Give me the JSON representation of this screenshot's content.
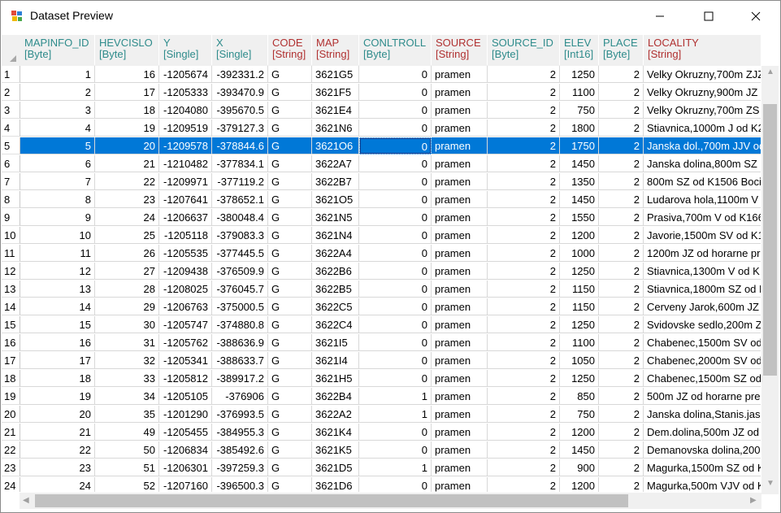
{
  "window": {
    "title": "Dataset Preview"
  },
  "columns": [
    {
      "name": "MAPINFO_ID",
      "type": "[Byte]",
      "color": "#2e8b8b"
    },
    {
      "name": "HEVCISLO",
      "type": "[Byte]",
      "color": "#2e8b8b"
    },
    {
      "name": "Y",
      "type": "[Single]",
      "color": "#2e8b8b"
    },
    {
      "name": "X",
      "type": "[Single]",
      "color": "#2e8b8b"
    },
    {
      "name": "CODE",
      "type": "[String]",
      "color": "#b03030"
    },
    {
      "name": "MAP",
      "type": "[String]",
      "color": "#b03030"
    },
    {
      "name": "CONLTROLL",
      "type": "[Byte]",
      "color": "#2e8b8b"
    },
    {
      "name": "SOURCE",
      "type": "[String]",
      "color": "#b03030"
    },
    {
      "name": "SOURCE_ID",
      "type": "[Byte]",
      "color": "#2e8b8b"
    },
    {
      "name": "ELEV",
      "type": "[Int16]",
      "color": "#2e8b8b"
    },
    {
      "name": "PLACE",
      "type": "[Byte]",
      "color": "#2e8b8b"
    },
    {
      "name": "LOCALITY",
      "type": "[String]",
      "color": "#b03030"
    }
  ],
  "selected_row": 5,
  "rows": [
    {
      "n": "1",
      "v": [
        "1",
        "16",
        "-1205674",
        "-392331.2",
        "G",
        "3621G5",
        "0",
        "pramen",
        "2",
        "1250",
        "2",
        "Velky Okruzny,700m ZJZ"
      ]
    },
    {
      "n": "2",
      "v": [
        "2",
        "17",
        "-1205333",
        "-393470.9",
        "G",
        "3621F5",
        "0",
        "pramen",
        "2",
        "1100",
        "2",
        "Velky Okruzny,900m JZ"
      ]
    },
    {
      "n": "3",
      "v": [
        "3",
        "18",
        "-1204080",
        "-395670.5",
        "G",
        "3621E4",
        "0",
        "pramen",
        "2",
        "750",
        "2",
        "Velky Okruzny,700m ZS"
      ]
    },
    {
      "n": "4",
      "v": [
        "4",
        "19",
        "-1209519",
        "-379127.3",
        "G",
        "3621N6",
        "0",
        "pramen",
        "2",
        "1800",
        "2",
        "Stiavnica,1000m J od K2"
      ]
    },
    {
      "n": "5",
      "v": [
        "5",
        "20",
        "-1209578",
        "-378844.6",
        "G",
        "3621O6",
        "0",
        "pramen",
        "2",
        "1750",
        "2",
        "Janska dol.,700m JJV od"
      ]
    },
    {
      "n": "6",
      "v": [
        "6",
        "21",
        "-1210482",
        "-377834.1",
        "G",
        "3622A7",
        "0",
        "pramen",
        "2",
        "1450",
        "2",
        "Janska dolina,800m SZ od"
      ]
    },
    {
      "n": "7",
      "v": [
        "7",
        "22",
        "-1209971",
        "-377119.2",
        "G",
        "3622B7",
        "0",
        "pramen",
        "2",
        "1350",
        "2",
        "800m SZ od K1506 Boci"
      ]
    },
    {
      "n": "8",
      "v": [
        "8",
        "23",
        "-1207641",
        "-378652.1",
        "G",
        "3621O5",
        "0",
        "pramen",
        "2",
        "1450",
        "2",
        "Ludarova hola,1100m V"
      ]
    },
    {
      "n": "9",
      "v": [
        "9",
        "24",
        "-1206637",
        "-380048.4",
        "G",
        "3621N5",
        "0",
        "pramen",
        "2",
        "1550",
        "2",
        "Prasiva,700m V od K166"
      ]
    },
    {
      "n": "10",
      "v": [
        "10",
        "25",
        "-1205118",
        "-379083.3",
        "G",
        "3621N4",
        "0",
        "pramen",
        "2",
        "1200",
        "2",
        "Javorie,1500m SV od K1"
      ]
    },
    {
      "n": "11",
      "v": [
        "11",
        "26",
        "-1205535",
        "-377445.5",
        "G",
        "3622A4",
        "0",
        "pramen",
        "2",
        "1000",
        "2",
        "1200m JZ od horarne pre"
      ]
    },
    {
      "n": "12",
      "v": [
        "12",
        "27",
        "-1209438",
        "-376509.9",
        "G",
        "3622B6",
        "0",
        "pramen",
        "2",
        "1250",
        "2",
        "Stiavnica,1300m V od K"
      ]
    },
    {
      "n": "13",
      "v": [
        "13",
        "28",
        "-1208025",
        "-376045.7",
        "G",
        "3622B5",
        "0",
        "pramen",
        "2",
        "1150",
        "2",
        "Stiavnica,1800m SZ od K"
      ]
    },
    {
      "n": "14",
      "v": [
        "14",
        "29",
        "-1206763",
        "-375000.5",
        "G",
        "3622C5",
        "0",
        "pramen",
        "2",
        "1150",
        "2",
        "Cerveny Jarok,600m JZ"
      ]
    },
    {
      "n": "15",
      "v": [
        "15",
        "30",
        "-1205747",
        "-374880.8",
        "G",
        "3622C4",
        "0",
        "pramen",
        "2",
        "1250",
        "2",
        "Svidovske sedlo,200m Z"
      ]
    },
    {
      "n": "16",
      "v": [
        "16",
        "31",
        "-1205762",
        "-388636.9",
        "G",
        "3621I5",
        "0",
        "pramen",
        "2",
        "1100",
        "2",
        "Chabenec,1500m SV od"
      ]
    },
    {
      "n": "17",
      "v": [
        "17",
        "32",
        "-1205341",
        "-388633.7",
        "G",
        "3621I4",
        "0",
        "pramen",
        "2",
        "1050",
        "2",
        "Chabenec,2000m SV od"
      ]
    },
    {
      "n": "18",
      "v": [
        "18",
        "33",
        "-1205812",
        "-389917.2",
        "G",
        "3621H5",
        "0",
        "pramen",
        "2",
        "1250",
        "2",
        "Chabenec,1500m SZ od"
      ]
    },
    {
      "n": "19",
      "v": [
        "19",
        "34",
        "-1205105",
        "-376906",
        "G",
        "3622B4",
        "1",
        "pramen",
        "2",
        "850",
        "2",
        "500m JZ od horarne pre"
      ]
    },
    {
      "n": "20",
      "v": [
        "20",
        "35",
        "-1201290",
        "-376993.5",
        "G",
        "3622A2",
        "1",
        "pramen",
        "2",
        "750",
        "2",
        "Janska dolina,Stanis.jas"
      ]
    },
    {
      "n": "21",
      "v": [
        "21",
        "49",
        "-1205455",
        "-384955.3",
        "G",
        "3621K4",
        "0",
        "pramen",
        "2",
        "1200",
        "2",
        "Dem.dolina,500m JZ od"
      ]
    },
    {
      "n": "22",
      "v": [
        "22",
        "50",
        "-1206834",
        "-385492.6",
        "G",
        "3621K5",
        "0",
        "pramen",
        "2",
        "1450",
        "2",
        "Demanovska dolina,200"
      ]
    },
    {
      "n": "23",
      "v": [
        "23",
        "51",
        "-1206301",
        "-397259.3",
        "G",
        "3621D5",
        "1",
        "pramen",
        "2",
        "900",
        "2",
        "Magurka,1500m SZ od K"
      ]
    },
    {
      "n": "24",
      "v": [
        "24",
        "52",
        "-1207160",
        "-396500.3",
        "G",
        "3621D6",
        "0",
        "pramen",
        "2",
        "1200",
        "2",
        "Magurka,500m VJV od K"
      ]
    }
  ]
}
